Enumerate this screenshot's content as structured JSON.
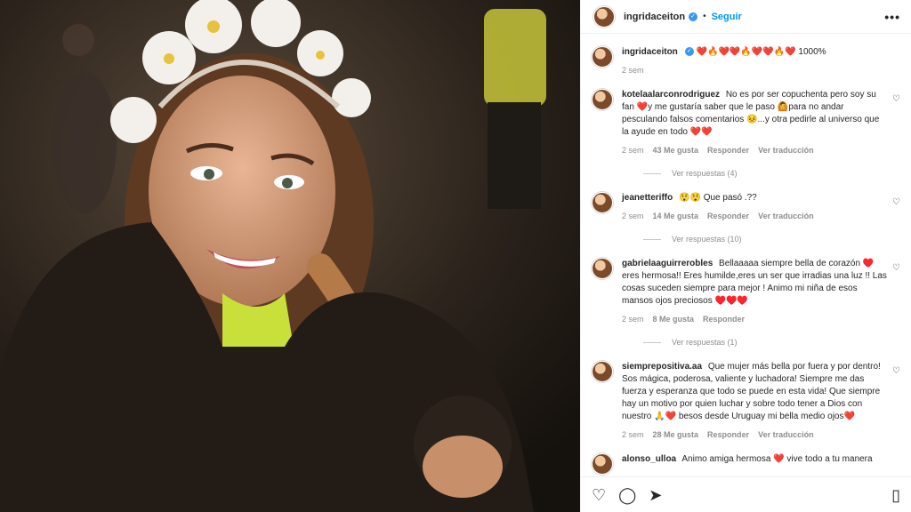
{
  "header": {
    "username": "ingridaceiton",
    "follow_label": "Seguir",
    "more_label": "•••"
  },
  "caption": {
    "username": "ingridaceiton",
    "text": "❤️🔥❤️❤️🔥❤️❤️🔥❤️ 1000%",
    "time": "2 sem"
  },
  "comments": [
    {
      "username": "kotelaalarconrodriguez",
      "text": "No es por ser copuchenta pero soy su fan ❤️y me gustaría saber que le paso 🙆para no andar pesculando falsos comentarios 😣...y otra pedirle al universo que la ayude en todo ❤️❤️",
      "time": "2 sem",
      "likes": "43 Me gusta",
      "reply": "Responder",
      "translate": "Ver traducción",
      "replies": "Ver respuestas (4)"
    },
    {
      "username": "jeanetteriffo",
      "text": "😲😲 Que pasó .??",
      "time": "2 sem",
      "likes": "14 Me gusta",
      "reply": "Responder",
      "translate": "Ver traducción",
      "replies": "Ver respuestas (10)"
    },
    {
      "username": "gabrielaaguirrerobles",
      "text": "Bellaaaaa siempre bella de corazón ♥️ eres hermosa!! Eres humilde,eres un ser que irradias una luz !! Las cosas suceden siempre para mejor ! Animo mi niña de esos mansos ojos preciosos ♥️♥️♥️",
      "time": "2 sem",
      "likes": "8 Me gusta",
      "reply": "Responder",
      "translate": "",
      "replies": "Ver respuestas (1)"
    },
    {
      "username": "siemprepositiva.aa",
      "text": "Que mujer más bella por fuera y por dentro! Sos mágica, poderosa, valiente y luchadora! Siempre me das fuerza y esperanza que todo se puede en esta vida! Que siempre hay un motivo por quien luchar y sobre todo tener a Dios con nuestro 🙏❤️ besos desde Uruguay mi bella medio ojos❤️",
      "time": "2 sem",
      "likes": "28 Me gusta",
      "reply": "Responder",
      "translate": "Ver traducción",
      "replies": ""
    },
    {
      "username": "alonso_ulloa",
      "text": "Animo amiga hermosa ❤️ vive todo a tu manera",
      "time": "",
      "likes": "",
      "reply": "",
      "translate": "",
      "replies": ""
    }
  ],
  "icons": {
    "like": "heart-icon",
    "comment": "comment-icon",
    "share": "share-icon",
    "save": "bookmark-icon"
  },
  "colors": {
    "accent": "#0095f6",
    "verified": "#3897f0"
  }
}
